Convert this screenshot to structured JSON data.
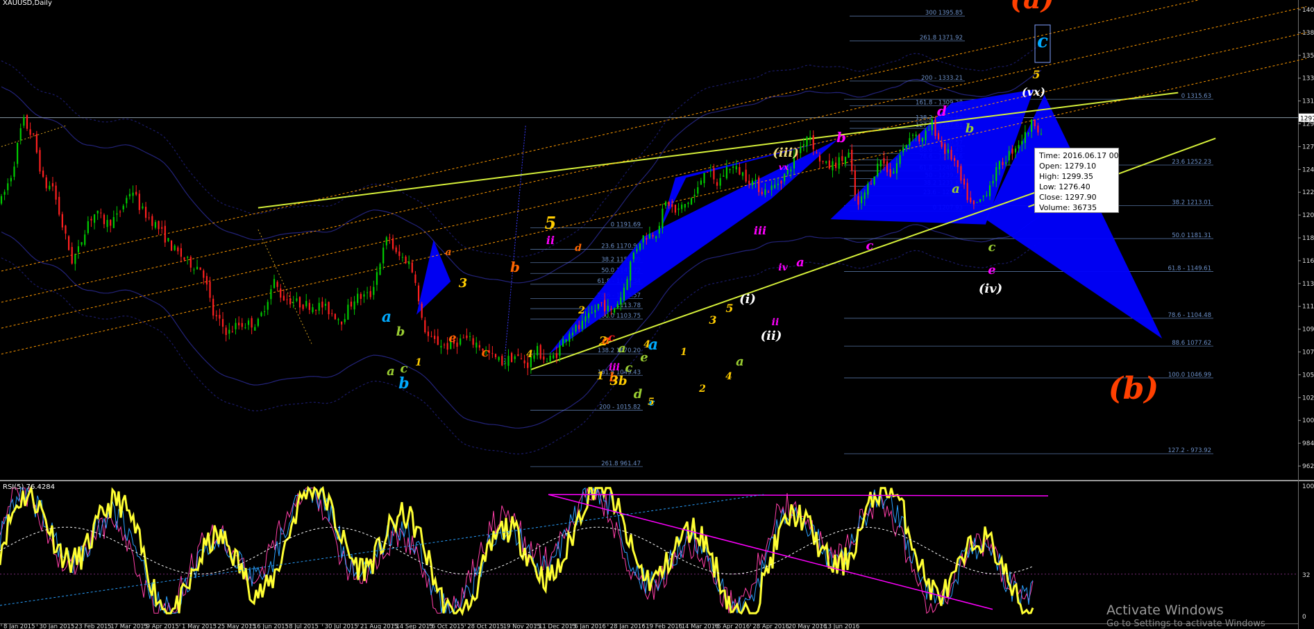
{
  "window": {
    "symbol_label": "XAUUSD,Daily",
    "rsi_label": "RSI(5) 76.4284"
  },
  "ohlc": {
    "time": "Time: 2016.06.17 00:00",
    "open": "Open: 1279.10",
    "high": "High: 1299.35",
    "low": "Low:  1276.40",
    "close": "Close: 1297.90",
    "volume": "Volume: 36735"
  },
  "watermark": {
    "line1": "Activate Windows",
    "line2": "Go to Settings to activate Windows"
  },
  "colors": {
    "background": "#000000",
    "bull": "#00cc00",
    "bear": "#ff2020",
    "fib": "#6b8fc7",
    "harmonic": "#0000ff",
    "trend_yellow": "#d6f03a",
    "rsi": "#ffff33",
    "divergence": "#ff00ff"
  },
  "chart_data": {
    "type": "candlestick",
    "instrument": "XAUUSD",
    "timeframe": "Daily",
    "ylim": [
      950,
      1410
    ],
    "price_ticks": [
      962,
      984,
      1006,
      1028,
      1050,
      1072,
      1094,
      1116,
      1138,
      1160,
      1182,
      1204,
      1226,
      1248,
      1270,
      1292,
      1314,
      1336,
      1358,
      1380,
      1402
    ],
    "price_tick_labels": [
      "962",
      "984",
      "1006",
      "1028",
      "1050",
      "1072",
      "1094",
      "1116",
      "1138",
      "1160",
      "1182",
      "1204",
      "1226",
      "1248",
      "1270",
      "1292",
      "1314",
      "1336",
      "1358",
      "1380",
      "1402"
    ],
    "current_price": 1297.9,
    "current_price_label": "1297",
    "date_labels": [
      "8 Jan 2015",
      "30 Jan 2015",
      "23 Feb 2015",
      "17 Mar 2015",
      "9 Apr 2015",
      "1 May 2015",
      "25 May 2015",
      "16 Jun 2015",
      "8 Jul 2015",
      "30 Jul 2015",
      "21 Aug 2015",
      "14 Sep 2015",
      "6 Oct 2015",
      "28 Oct 2015",
      "19 Nov 2015",
      "11 Dec 2015",
      "6 Jan 2016",
      "28 Jan 2016",
      "19 Feb 2016",
      "14 Mar 2016",
      "6 Apr 2016",
      "28 Apr 2016",
      "20 May 2016",
      "13 Jun 2016"
    ],
    "price_path": [
      [
        0,
        1218
      ],
      [
        10,
        1245
      ],
      [
        20,
        1296
      ],
      [
        30,
        1278
      ],
      [
        40,
        1232
      ],
      [
        48,
        1232
      ],
      [
        55,
        1201
      ],
      [
        66,
        1160
      ],
      [
        72,
        1170
      ],
      [
        80,
        1197
      ],
      [
        88,
        1206
      ],
      [
        98,
        1196
      ],
      [
        108,
        1202
      ],
      [
        122,
        1230
      ],
      [
        130,
        1210
      ],
      [
        145,
        1194
      ],
      [
        160,
        1172
      ],
      [
        175,
        1158
      ],
      [
        188,
        1152
      ],
      [
        198,
        1108
      ],
      [
        212,
        1090
      ],
      [
        220,
        1098
      ],
      [
        240,
        1100
      ],
      [
        255,
        1140
      ],
      [
        262,
        1125
      ],
      [
        280,
        1118
      ],
      [
        300,
        1116
      ],
      [
        318,
        1103
      ],
      [
        330,
        1124
      ],
      [
        345,
        1127
      ],
      [
        352,
        1153
      ],
      [
        362,
        1186
      ],
      [
        368,
        1166
      ],
      [
        380,
        1160
      ],
      [
        387,
        1143
      ],
      [
        392,
        1104
      ],
      [
        400,
        1084
      ],
      [
        418,
        1077
      ],
      [
        432,
        1085
      ],
      [
        445,
        1080
      ],
      [
        458,
        1068
      ],
      [
        468,
        1062
      ],
      [
        480,
        1068
      ],
      [
        492,
        1060
      ],
      [
        500,
        1074
      ],
      [
        510,
        1063
      ],
      [
        518,
        1069
      ],
      [
        530,
        1092
      ],
      [
        540,
        1095
      ],
      [
        550,
        1106
      ],
      [
        560,
        1120
      ],
      [
        570,
        1110
      ],
      [
        580,
        1127
      ],
      [
        590,
        1165
      ],
      [
        598,
        1182
      ],
      [
        612,
        1188
      ],
      [
        622,
        1218
      ],
      [
        630,
        1206
      ],
      [
        640,
        1215
      ],
      [
        650,
        1225
      ],
      [
        658,
        1252
      ],
      [
        668,
        1232
      ],
      [
        680,
        1252
      ],
      [
        690,
        1246
      ],
      [
        700,
        1238
      ],
      [
        712,
        1227
      ],
      [
        722,
        1231
      ],
      [
        735,
        1246
      ],
      [
        748,
        1272
      ],
      [
        755,
        1284
      ],
      [
        762,
        1262
      ],
      [
        772,
        1250
      ],
      [
        782,
        1255
      ],
      [
        792,
        1262
      ],
      [
        800,
        1210
      ],
      [
        810,
        1232
      ],
      [
        822,
        1258
      ],
      [
        832,
        1242
      ],
      [
        842,
        1266
      ],
      [
        852,
        1285
      ],
      [
        860,
        1274
      ],
      [
        870,
        1292
      ],
      [
        880,
        1268
      ],
      [
        890,
        1258
      ],
      [
        898,
        1233
      ],
      [
        908,
        1210
      ],
      [
        918,
        1222
      ],
      [
        932,
        1250
      ],
      [
        946,
        1268
      ],
      [
        958,
        1282
      ],
      [
        965,
        1296
      ],
      [
        972,
        1283
      ]
    ],
    "fibonacci_1": [
      {
        "label": "300 1395.85",
        "price": 1395.85
      },
      {
        "label": "261.8 1371.92",
        "price": 1371.92
      },
      {
        "label": "200 - 1333.21",
        "price": 1333.21
      },
      {
        "label": "161.8 - 1309.28",
        "price": 1309.28
      },
      {
        "label": "138.2 - 1294.50",
        "price": 1294.5
      },
      {
        "label": "127.2 - 1287.61",
        "price": 1287.61
      },
      {
        "label": "100 - 1270.57",
        "price": 1270.57
      },
      {
        "label": "88.6 - 1263.43",
        "price": 1263.43
      },
      {
        "label": "78.6 - 1257.16",
        "price": 1257.16
      },
      {
        "label": "61.8 - 1246.64",
        "price": 1246.64
      },
      {
        "label": "50 - 1239.25",
        "price": 1239.25
      },
      {
        "label": "38.2 1231.85",
        "price": 1231.85
      },
      {
        "label": "23.6 - 1222.7",
        "price": 1222.7
      },
      {
        "label": "0 1207.93",
        "price": 1207.93
      }
    ],
    "fibonacci_2": [
      {
        "label": "0 1191.69",
        "price": 1191.69
      },
      {
        "label": "23.6 1170.93",
        "price": 1170.93
      },
      {
        "label": "38.2 1158.09",
        "price": 1158.09
      },
      {
        "label": "50.0 1147.72",
        "price": 1147.72
      },
      {
        "label": "61.8 - 1137.34",
        "price": 1137.34
      },
      {
        "label": "78.6 - 1123.57",
        "price": 1123.57
      },
      {
        "label": "88.6 - 1113.78",
        "price": 1113.78
      },
      {
        "label": "100.0 1103.75",
        "price": 1103.75
      },
      {
        "label": "138.2 1070.20",
        "price": 1070.2
      },
      {
        "label": "161.8 1049.43",
        "price": 1049.43
      },
      {
        "label": "200 - 1015.82",
        "price": 1015.82
      },
      {
        "label": "261.8 961.47",
        "price": 961.47
      }
    ],
    "fibonacci_3": [
      {
        "label": "0 1315.63",
        "price": 1315.63
      },
      {
        "label": "23.6 1252.23",
        "price": 1252.23
      },
      {
        "label": "38.2 1213.01",
        "price": 1213.01
      },
      {
        "label": "50.0 1181.31",
        "price": 1181.31
      },
      {
        "label": "61.8 - 1149.61",
        "price": 1149.61
      },
      {
        "label": "78.6 - 1104.48",
        "price": 1104.48
      },
      {
        "label": "88.6 1077.62",
        "price": 1077.62
      },
      {
        "label": "100.0 1046.99",
        "price": 1046.99
      },
      {
        "label": "127.2 - 973.92",
        "price": 973.92
      }
    ],
    "wave_labels": [
      {
        "text": "(a)",
        "color": "#ff4000"
      },
      {
        "text": "(b)",
        "color": "#ff4000"
      },
      {
        "text": "c",
        "color": "#00aaff"
      },
      {
        "text": "5",
        "color": "#ffcc00"
      },
      {
        "text": "(vx)",
        "color": "#ffffff"
      },
      {
        "text": "(iii)",
        "color": "#f0e080"
      },
      {
        "text": "vx",
        "color": "#ff00ff"
      },
      {
        "text": "b",
        "color": "#ff00ff"
      },
      {
        "text": "d",
        "color": "#ff00ff"
      },
      {
        "text": "b",
        "color": "#9acd32"
      },
      {
        "text": "a",
        "color": "#9acd32"
      },
      {
        "text": "c",
        "color": "#ff00ff"
      },
      {
        "text": "c",
        "color": "#9acd32"
      },
      {
        "text": "e",
        "color": "#ff00ff"
      },
      {
        "text": "(iv)",
        "color": "#ffffff"
      },
      {
        "text": "iii",
        "color": "#ff00ff"
      },
      {
        "text": "iv",
        "color": "#ff00ff"
      },
      {
        "text": "a",
        "color": "#ff00ff"
      },
      {
        "text": "(i)",
        "color": "#ffffff"
      },
      {
        "text": "ii",
        "color": "#ff00ff"
      },
      {
        "text": "(ii)",
        "color": "#ffffff"
      },
      {
        "text": "3",
        "color": "#ffcc00"
      },
      {
        "text": "1",
        "color": "#ffcc00"
      },
      {
        "text": "2",
        "color": "#ffcc00"
      },
      {
        "text": "4",
        "color": "#ffcc00"
      },
      {
        "text": "a",
        "color": "#9acd32"
      },
      {
        "text": "5",
        "color": "#ffcc00"
      },
      {
        "text": "c",
        "color": "#00aaff"
      },
      {
        "text": "5",
        "color": "#ffcc00"
      },
      {
        "text": "ii",
        "color": "#ff00ff"
      },
      {
        "text": "d",
        "color": "#ff6600"
      },
      {
        "text": "b",
        "color": "#ff6600"
      },
      {
        "text": "3",
        "color": "#ffcc00"
      },
      {
        "text": "a",
        "color": "#ff6600"
      },
      {
        "text": "e",
        "color": "#ff6600"
      },
      {
        "text": "c",
        "color": "#ff6600"
      },
      {
        "text": "4",
        "color": "#ffcc00"
      },
      {
        "text": "a",
        "color": "#00aaff"
      },
      {
        "text": "b",
        "color": "#9acd32"
      },
      {
        "text": "c",
        "color": "#9acd32"
      },
      {
        "text": "a",
        "color": "#9acd32"
      },
      {
        "text": "b",
        "color": "#00aaff"
      },
      {
        "text": "1",
        "color": "#ffcc00"
      },
      {
        "text": "2",
        "color": "#ffcc00"
      },
      {
        "text": "iii",
        "color": "#ff00ff"
      },
      {
        "text": "2",
        "color": "#ffcc00"
      },
      {
        "text": "a",
        "color": "#ff6600"
      },
      {
        "text": "c",
        "color": "#ff2020"
      },
      {
        "text": "1",
        "color": "#ffcc00"
      },
      {
        "text": "b",
        "color": "#ff6600"
      },
      {
        "text": "3b",
        "color": "#ffcc00"
      },
      {
        "text": "a",
        "color": "#9acd32"
      },
      {
        "text": "c",
        "color": "#9acd32"
      },
      {
        "text": "e",
        "color": "#9acd32"
      },
      {
        "text": "4",
        "color": "#ffcc00"
      },
      {
        "text": "a",
        "color": "#00aaff"
      },
      {
        "text": "d",
        "color": "#9acd32"
      },
      {
        "text": "5",
        "color": "#ffcc00"
      }
    ],
    "rsi": {
      "period": 5,
      "value": 76.4284,
      "ylim": [
        0,
        100
      ],
      "tick_labels": [
        "100",
        "32",
        "0"
      ]
    }
  }
}
